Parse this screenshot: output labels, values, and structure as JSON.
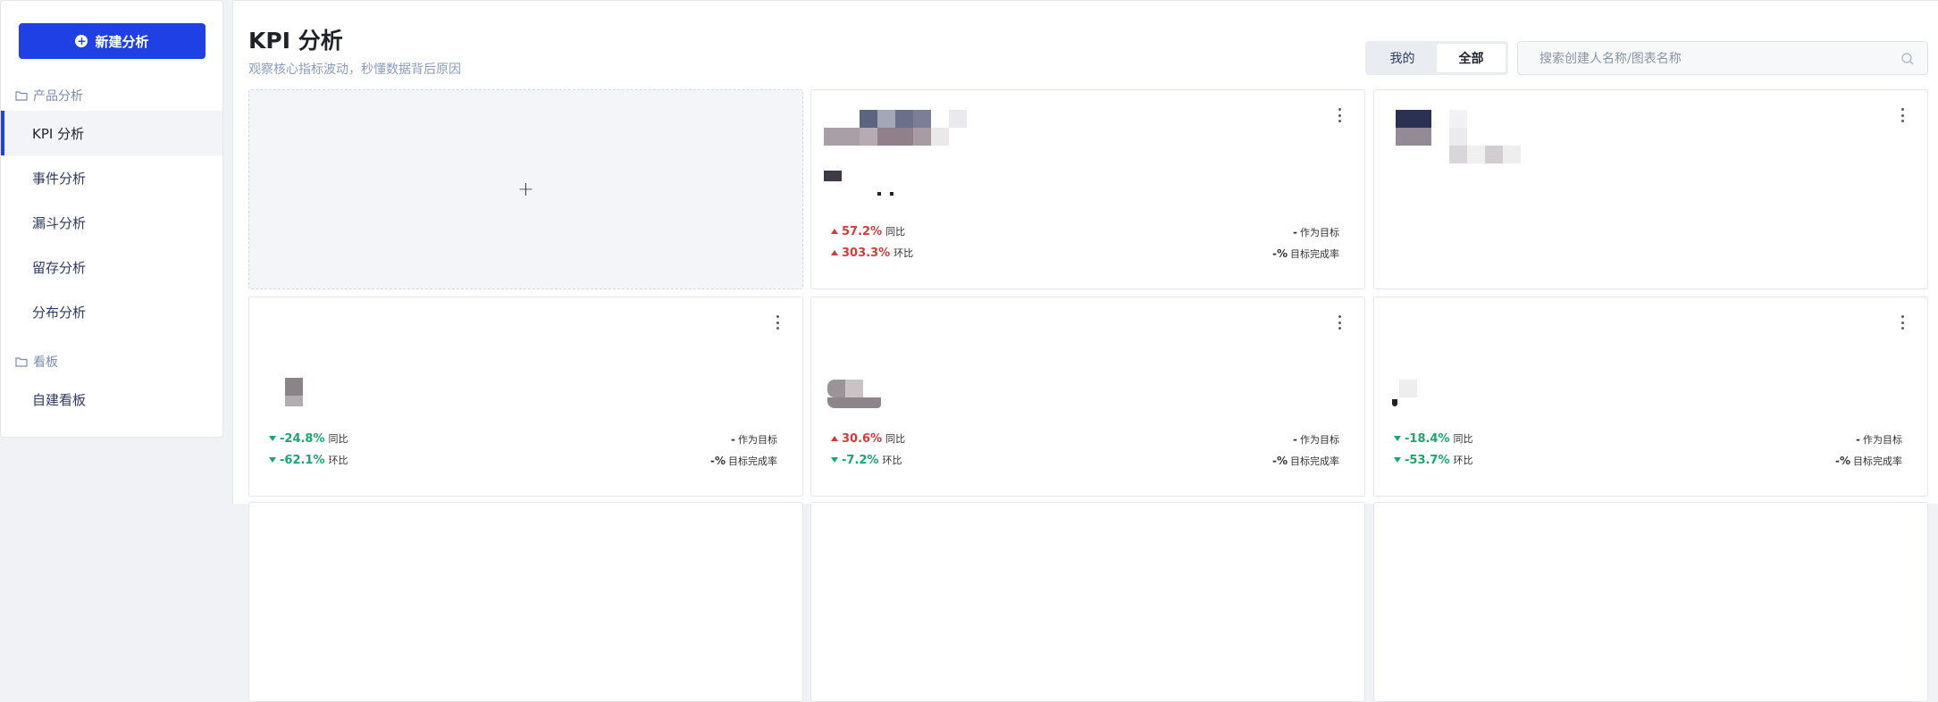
{
  "sidebar": {
    "new_button": "新建分析",
    "groups": [
      {
        "title": "产品分析",
        "items": [
          "KPI 分析",
          "事件分析",
          "漏斗分析",
          "留存分析",
          "分布分析"
        ]
      },
      {
        "title": "看板",
        "items": [
          "自建看板"
        ]
      }
    ],
    "active_item": "KPI 分析"
  },
  "header": {
    "title": "KPI 分析",
    "subtitle": "观察核心指标波动，秒懂数据背后原因",
    "tabs": [
      "我的",
      "全部"
    ],
    "active_tab": "全部",
    "search_placeholder": "搜索创建人名称/图表名称"
  },
  "add_card": {
    "icon": "+"
  },
  "cards": [
    {
      "yoy": "57.2%",
      "yoy_dir": "up",
      "yoy_label": "同比",
      "mom": "303.3%",
      "mom_dir": "up",
      "mom_label": "环比",
      "target_value": "-",
      "target_label": "作为目标",
      "completion_value": "-%",
      "completion_label": "目标完成率"
    },
    {
      "yoy": "",
      "mom": ""
    },
    {
      "yoy": "-24.8%",
      "yoy_dir": "down",
      "yoy_label": "同比",
      "mom": "-62.1%",
      "mom_dir": "down",
      "mom_label": "环比",
      "target_value": "-",
      "target_label": "作为目标",
      "completion_value": "-%",
      "completion_label": "目标完成率"
    },
    {
      "yoy": "30.6%",
      "yoy_dir": "up",
      "yoy_label": "同比",
      "mom": "-7.2%",
      "mom_dir": "down",
      "mom_label": "环比",
      "target_value": "-",
      "target_label": "作为目标",
      "completion_value": "-%",
      "completion_label": "目标完成率"
    },
    {
      "yoy": "-18.4%",
      "yoy_dir": "down",
      "yoy_label": "同比",
      "mom": "-53.7%",
      "mom_dir": "down",
      "mom_label": "环比",
      "target_value": "-",
      "target_label": "作为目标",
      "completion_value": "-%",
      "completion_label": "目标完成率"
    }
  ],
  "colors": {
    "accent": "#1e40e5",
    "up": "#d63a3a",
    "down": "#1aa66e"
  }
}
